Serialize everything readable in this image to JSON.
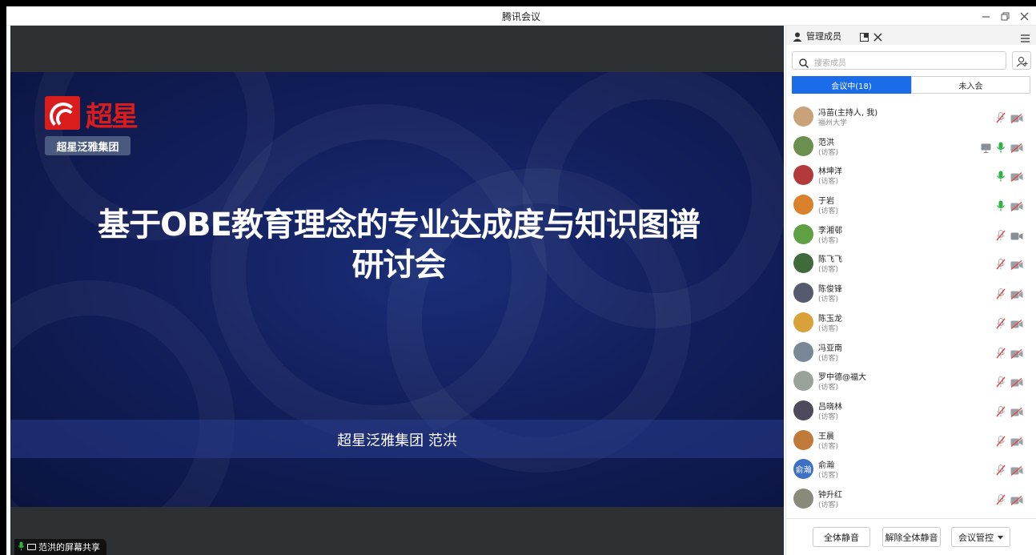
{
  "window": {
    "title": "腾讯会议"
  },
  "stage": {
    "slide": {
      "logo_text": "超星",
      "group_tag": "超星泛雅集团",
      "title_line1": "基于OBE教育理念的专业达成度与知识图谱",
      "title_line2": "研讨会",
      "presenter": "超星泛雅集团 范洪"
    },
    "share_label": "范洪的屏幕共享"
  },
  "panel": {
    "title": "管理成员",
    "search_placeholder": "搜索成员",
    "tabs": [
      {
        "label": "会议中(18)",
        "active": true
      },
      {
        "label": "未入会",
        "active": false
      }
    ],
    "members": [
      {
        "name": "冯苗(主持人, 我)",
        "role": "福州大学",
        "mic": "muted",
        "cam": "off",
        "avatar_color": "#c9a27a",
        "avatar_text": ""
      },
      {
        "name": "范洪",
        "role": "(访客)",
        "mic": "on",
        "cam": "off",
        "sharing": true,
        "avatar_color": "#6b8f4e",
        "avatar_text": ""
      },
      {
        "name": "林坤洋",
        "role": "(访客)",
        "mic": "on",
        "cam": "off",
        "avatar_color": "#b33a3a",
        "avatar_text": ""
      },
      {
        "name": "于岩",
        "role": "(访客)",
        "mic": "on",
        "cam": "off",
        "avatar_color": "#d9822b",
        "avatar_text": ""
      },
      {
        "name": "李湘邨",
        "role": "(访客)",
        "mic": "muted",
        "cam": "on",
        "avatar_color": "#5fa043",
        "avatar_text": ""
      },
      {
        "name": "陈飞飞",
        "role": "(访客)",
        "mic": "muted",
        "cam": "off",
        "avatar_color": "#3f6b3a",
        "avatar_text": ""
      },
      {
        "name": "陈俊锋",
        "role": "(访客)",
        "mic": "muted",
        "cam": "off",
        "avatar_color": "#555a6e",
        "avatar_text": ""
      },
      {
        "name": "陈玉龙",
        "role": "(访客)",
        "mic": "muted",
        "cam": "off",
        "avatar_color": "#d8a13a",
        "avatar_text": ""
      },
      {
        "name": "冯亚南",
        "role": "(访客)",
        "mic": "muted",
        "cam": "off",
        "avatar_color": "#7a8796",
        "avatar_text": ""
      },
      {
        "name": "罗中德@福大",
        "role": "(访客)",
        "mic": "muted",
        "cam": "off",
        "avatar_color": "#9aa39a",
        "avatar_text": ""
      },
      {
        "name": "吕晓林",
        "role": "(访客)",
        "mic": "muted",
        "cam": "off",
        "avatar_color": "#4e4a5c",
        "avatar_text": ""
      },
      {
        "name": "王晨",
        "role": "(访客)",
        "mic": "muted",
        "cam": "off",
        "avatar_color": "#c07a3a",
        "avatar_text": ""
      },
      {
        "name": "俞瀚",
        "role": "(访客)",
        "mic": "muted",
        "cam": "off",
        "avatar_color": "#3d6fc4",
        "avatar_text": "俞瀚"
      },
      {
        "name": "钟升红",
        "role": "(访客)",
        "mic": "muted",
        "cam": "off",
        "avatar_color": "#8a8a7a",
        "avatar_text": ""
      }
    ],
    "footer": {
      "mute_all": "全体静音",
      "unmute_all": "解除全体静音",
      "meeting_control": "会议管控"
    }
  },
  "colors": {
    "accent": "#1a6ce8",
    "mic_on": "#2fb344",
    "mic_muted": "#e04848"
  }
}
